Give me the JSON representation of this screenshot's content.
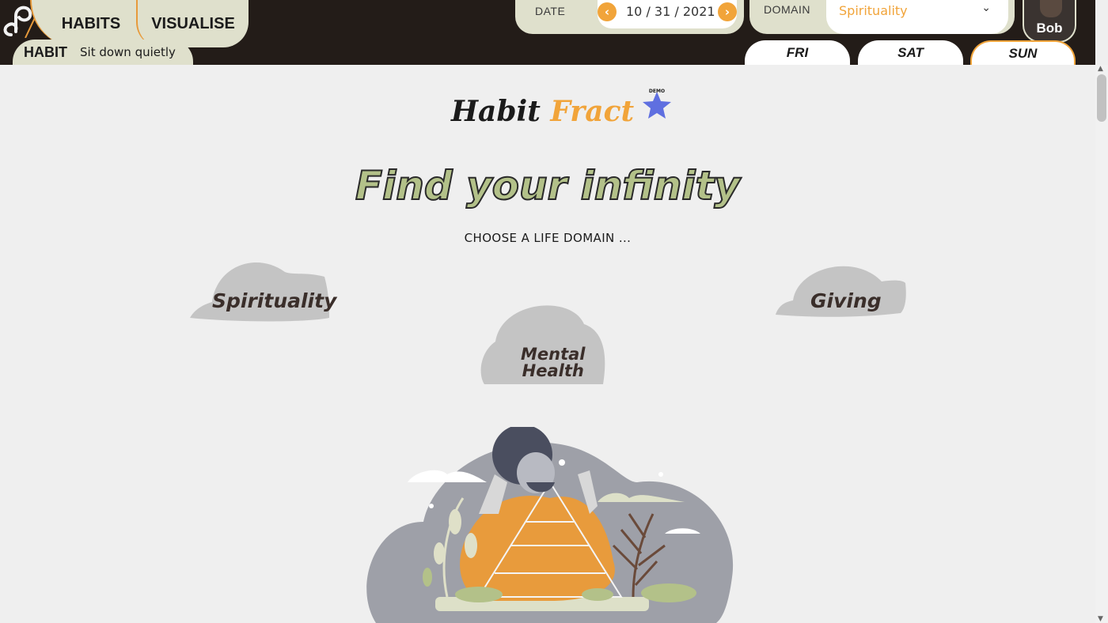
{
  "nav": {
    "habits_label": "HABITS",
    "visualise_label": "VISUALISE",
    "habit_label": "HABIT",
    "habit_value": "Sit down quietly"
  },
  "date": {
    "label": "DATE",
    "value": "10 / 31 / 2021",
    "prev_icon": "chevron-left-icon",
    "next_icon": "chevron-right-icon"
  },
  "domain": {
    "label": "DOMAIN",
    "selected": "Spirituality"
  },
  "user": {
    "name": "Bob"
  },
  "days": [
    "FRI",
    "SAT",
    "SUN"
  ],
  "active_day": "SUN",
  "brand": {
    "part1": "Habit",
    "part2": "Fract",
    "badge": "DEMO"
  },
  "hero": {
    "title": "Find your infinity",
    "subtitle": "CHOOSE A LIFE DOMAIN ..."
  },
  "domains": [
    "Spirituality",
    "Giving",
    "Mental Health"
  ],
  "domains_mental_line1": "Mental",
  "domains_mental_line2": "Health",
  "colors": {
    "accent": "#f1a43a",
    "topbar": "#231c18",
    "tab": "#dfe0cc",
    "hero_fill": "#b3c189",
    "cloud": "#c4c4c4"
  }
}
